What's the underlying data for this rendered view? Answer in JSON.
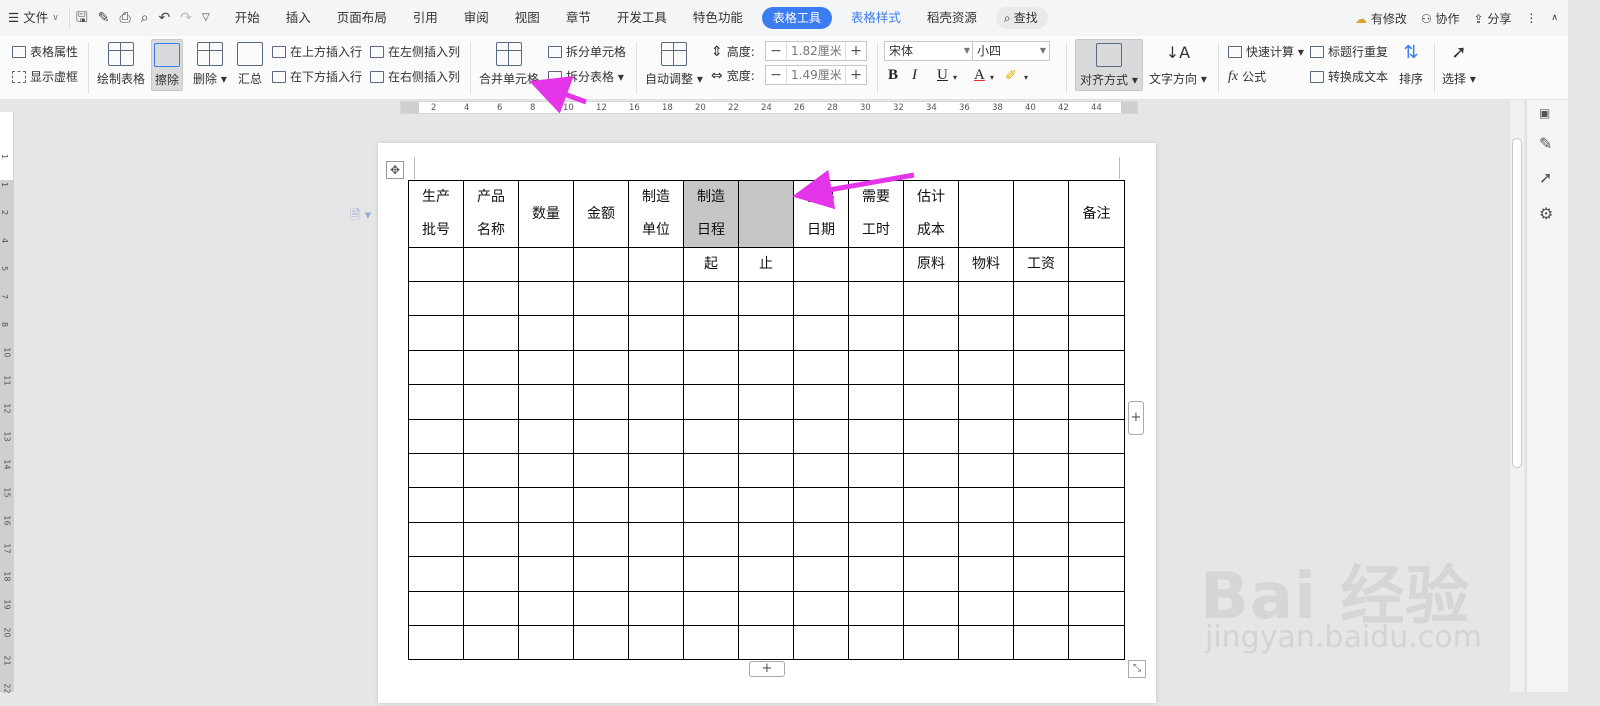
{
  "menubar": {
    "file_label": "文件",
    "quick_access_icons": [
      "save-icon",
      "format-painter-icon",
      "print-icon",
      "print-preview-icon",
      "undo-icon",
      "redo-icon",
      "more-icon"
    ],
    "tabs": [
      "开始",
      "插入",
      "页面布局",
      "引用",
      "审阅",
      "视图",
      "章节",
      "开发工具",
      "特色功能"
    ],
    "active_tab": "表格工具",
    "blue_tab": "表格样式",
    "extra_tab": "稻壳资源",
    "search_label": "查找",
    "right": {
      "modified": "有修改",
      "collab": "协作",
      "share": "分享"
    }
  },
  "ribbon": {
    "table_props": "表格属性",
    "show_grid": "显示虚框",
    "draw_table": "绘制表格",
    "erase": "擦除",
    "delete": "删除",
    "summary": "汇总",
    "insert_above": "在上方插入行",
    "insert_below": "在下方插入行",
    "insert_left": "在左侧插入列",
    "insert_right": "在右侧插入列",
    "merge_cells": "合并单元格",
    "split_cells": "拆分单元格",
    "split_table": "拆分表格",
    "auto_fit": "自动调整",
    "height_label": "高度:",
    "height_value": "1.82厘米",
    "width_label": "宽度:",
    "width_value": "1.49厘米",
    "font_name": "宋体",
    "font_size": "小四",
    "bold": "B",
    "italic": "I",
    "underline": "U",
    "font_color": "A",
    "align": "对齐方式",
    "text_direction": "文字方向",
    "quick_calc": "快速计算",
    "formula": "公式",
    "repeat_header": "标题行重复",
    "convert_text": "转换成文本",
    "sort": "排序",
    "select": "选择"
  },
  "ruler": {
    "h_ticks": [
      "2",
      "4",
      "6",
      "8",
      "10",
      "12",
      "16",
      "18",
      "20",
      "22",
      "24",
      "26",
      "28",
      "30",
      "32",
      "34",
      "36",
      "38",
      "40",
      "42",
      "44"
    ],
    "v_ticks": [
      "1",
      "1",
      "2",
      "4",
      "5",
      "7",
      "8",
      "10",
      "11",
      "12",
      "13",
      "14",
      "15",
      "16",
      "17",
      "18",
      "19",
      "20",
      "21",
      "22"
    ]
  },
  "table": {
    "header_row1": [
      "生产\n批号",
      "产品\n名称",
      "数量",
      "金额",
      "制造\n单位",
      "制造\n日程",
      "",
      "预出\n日期",
      "需要\n工时",
      "估计\n成本",
      "",
      "",
      "备注"
    ],
    "header_row2": [
      "",
      "",
      "",
      "",
      "",
      "起",
      "止",
      "",
      "",
      "原料",
      "物料",
      "工资",
      ""
    ],
    "empty_rows": 11,
    "columns": 13
  },
  "colors": {
    "accent": "#3b7cf0",
    "arrow": "#e436e8",
    "selected_cell": "#c6c6c6"
  },
  "watermark": {
    "logo": "Bai 经验",
    "url": "jingyan.baidu.com"
  }
}
